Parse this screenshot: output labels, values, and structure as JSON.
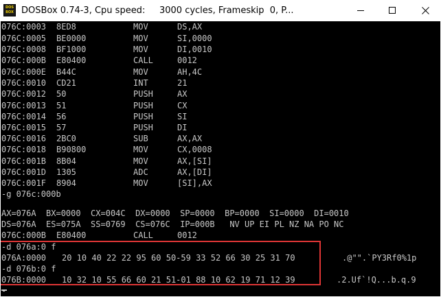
{
  "window": {
    "title": "DOSBox 0.74-3, Cpu speed:     3000 cycles, Frameskip  0, P...",
    "icon_line1": "DOS",
    "icon_line2": "BOX",
    "icon_name": "dosbox-icon",
    "buttons": [
      "minimize",
      "maximize",
      "close"
    ]
  },
  "console": {
    "disasm": [
      {
        "addr": "076C:0003",
        "bytes": "8ED8",
        "op": "MOV",
        "args": "DS,AX"
      },
      {
        "addr": "076C:0005",
        "bytes": "BE0000",
        "op": "MOV",
        "args": "SI,0000"
      },
      {
        "addr": "076C:0008",
        "bytes": "BF1000",
        "op": "MOV",
        "args": "DI,0010"
      },
      {
        "addr": "076C:000B",
        "bytes": "E80400",
        "op": "CALL",
        "args": "0012"
      },
      {
        "addr": "076C:000E",
        "bytes": "B44C",
        "op": "MOV",
        "args": "AH,4C"
      },
      {
        "addr": "076C:0010",
        "bytes": "CD21",
        "op": "INT",
        "args": "21"
      },
      {
        "addr": "076C:0012",
        "bytes": "50",
        "op": "PUSH",
        "args": "AX"
      },
      {
        "addr": "076C:0013",
        "bytes": "51",
        "op": "PUSH",
        "args": "CX"
      },
      {
        "addr": "076C:0014",
        "bytes": "56",
        "op": "PUSH",
        "args": "SI"
      },
      {
        "addr": "076C:0015",
        "bytes": "57",
        "op": "PUSH",
        "args": "DI"
      },
      {
        "addr": "076C:0016",
        "bytes": "2BC0",
        "op": "SUB",
        "args": "AX,AX"
      },
      {
        "addr": "076C:0018",
        "bytes": "B90800",
        "op": "MOV",
        "args": "CX,0008"
      },
      {
        "addr": "076C:001B",
        "bytes": "8B04",
        "op": "MOV",
        "args": "AX,[SI]"
      },
      {
        "addr": "076C:001D",
        "bytes": "1305",
        "op": "ADC",
        "args": "AX,[DI]"
      },
      {
        "addr": "076C:001F",
        "bytes": "8904",
        "op": "MOV",
        "args": "[SI],AX"
      }
    ],
    "go_command": "-g 076c:000b",
    "registers_line1": "AX=076A  BX=0000  CX=004C  DX=0000  SP=0000  BP=0000  SI=0000  DI=0010",
    "registers_line2": "DS=076A  ES=075A  SS=0769  CS=076C  IP=000B   NV UP EI PL NZ NA PO NC",
    "current_instr": {
      "addr": "076C:000B",
      "bytes": "E80400",
      "op": "CALL",
      "args": "0012"
    },
    "dump_cmd_1": "-d 076a:0 f",
    "dump_row_1": {
      "addr": "076A:0000",
      "hex": "20 10 40 22 22 95 60 50-59 33 52 66 30 25 31 70",
      "ascii": ".@\"\".`PY3Rf0%1p"
    },
    "dump_cmd_2": "-d 076b:0 f",
    "dump_row_2": {
      "addr": "076B:0000",
      "hex": "10 32 10 55 66 60 21 51-01 88 10 62 19 71 12 39",
      "ascii": ".2.Uf`!Q...b.q.9"
    },
    "prompt": "-",
    "highlight_color": "#e03636",
    "text_color": "#c8c8c8",
    "background": "#000000"
  }
}
